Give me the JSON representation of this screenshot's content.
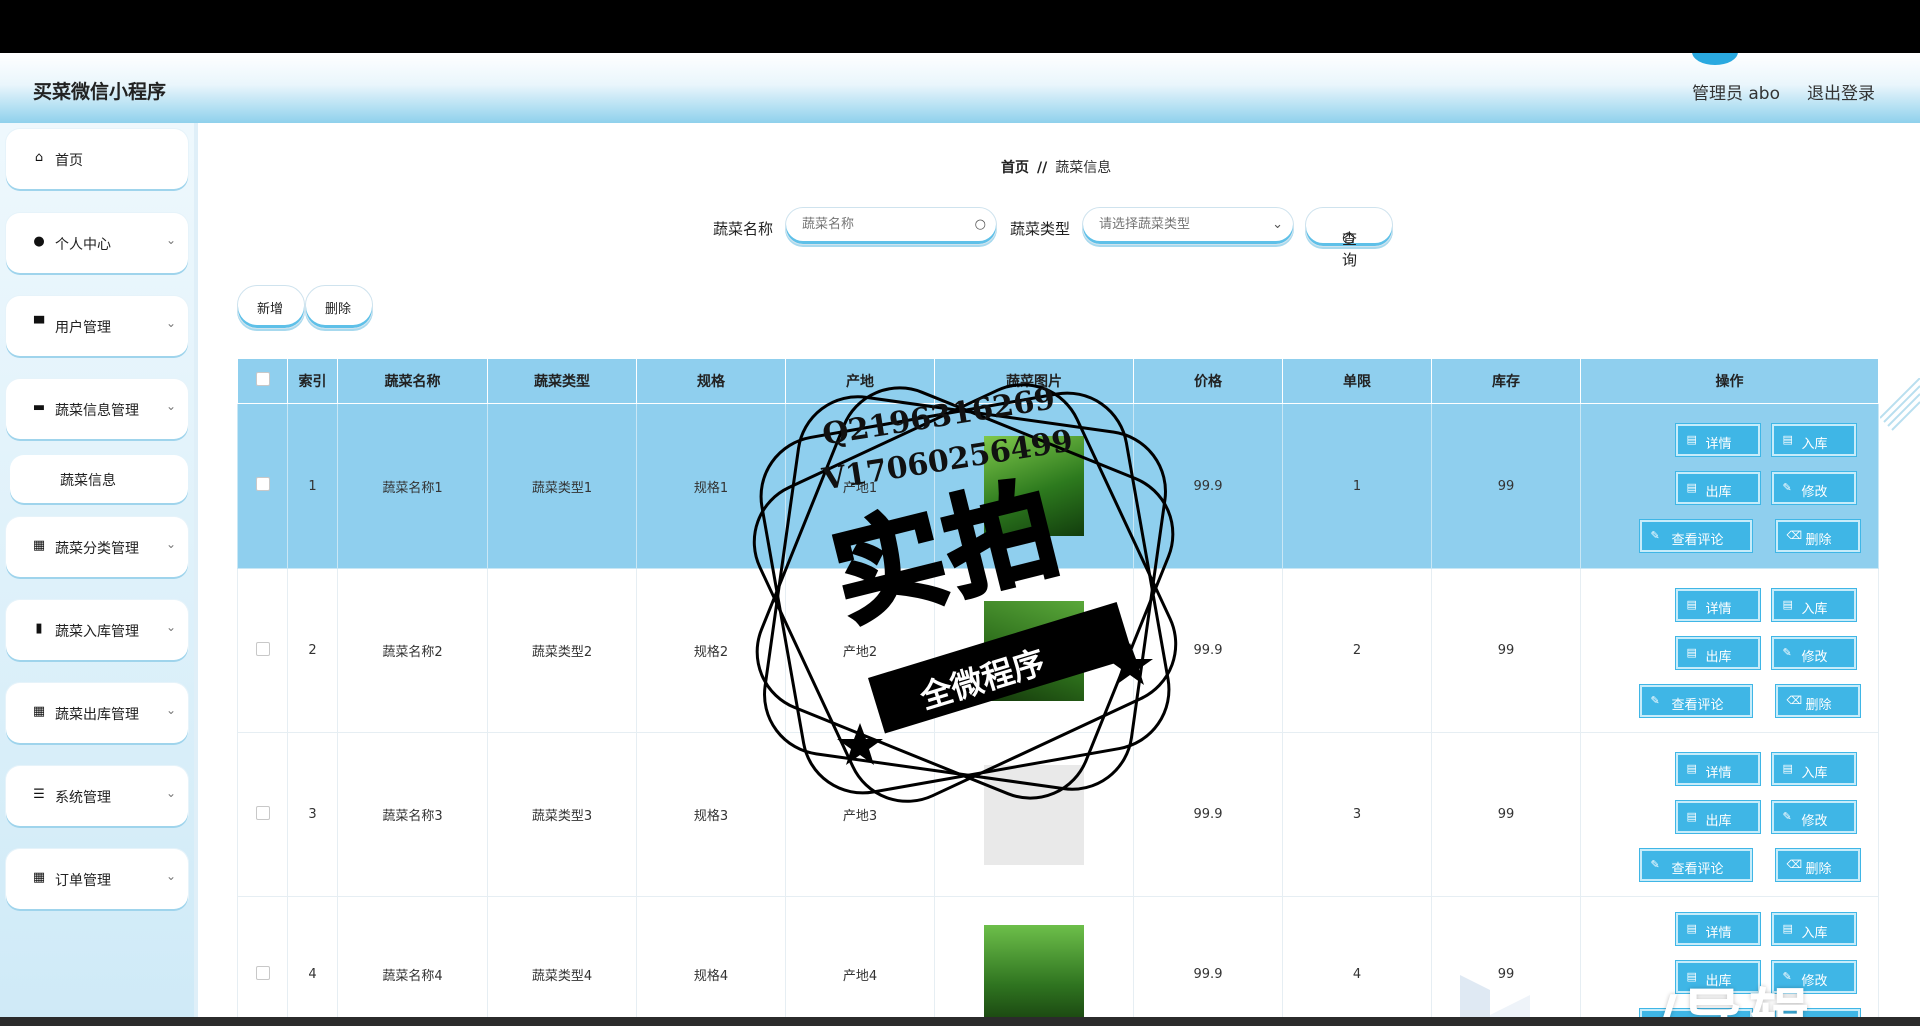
{
  "header": {
    "title": "买菜微信小程序",
    "user": "管理员 abo",
    "logout": "退出登录"
  },
  "sidebar": {
    "items": [
      {
        "label": "首页",
        "icon": "home-icon",
        "glyph": "⌂"
      },
      {
        "label": "个人中心",
        "icon": "user-icon",
        "glyph": "●"
      },
      {
        "label": "用户管理",
        "icon": "users-icon",
        "glyph": "▀"
      },
      {
        "label": "蔬菜信息管理",
        "icon": "chat-icon",
        "glyph": "▬"
      },
      {
        "label": "蔬菜分类管理",
        "icon": "grid-icon",
        "glyph": "▦"
      },
      {
        "label": "蔬菜入库管理",
        "icon": "inbox-icon",
        "glyph": "▮"
      },
      {
        "label": "蔬菜出库管理",
        "icon": "grid-icon",
        "glyph": "▦"
      },
      {
        "label": "系统管理",
        "icon": "list-icon",
        "glyph": "☰"
      },
      {
        "label": "订单管理",
        "icon": "grid-icon",
        "glyph": "▦"
      }
    ],
    "sub_item": "蔬菜信息"
  },
  "breadcrumb": {
    "home": "首页",
    "sep": "//",
    "current": "蔬菜信息"
  },
  "search": {
    "name_label": "蔬菜名称",
    "name_placeholder": "蔬菜名称",
    "type_label": "蔬菜类型",
    "type_placeholder": "请选择蔬菜类型",
    "query": "查询"
  },
  "actions": {
    "add": "新增",
    "delete": "删除"
  },
  "table": {
    "headers": [
      "索引",
      "蔬菜名称",
      "蔬菜类型",
      "规格",
      "产地",
      "蔬菜图片",
      "价格",
      "单限",
      "库存",
      "操作"
    ],
    "rows": [
      {
        "index": "1",
        "name": "蔬菜名称1",
        "type": "蔬菜类型1",
        "spec": "规格1",
        "origin": "产地1",
        "price": "99.9",
        "limit": "1",
        "stock": "99"
      },
      {
        "index": "2",
        "name": "蔬菜名称2",
        "type": "蔬菜类型2",
        "spec": "规格2",
        "origin": "产地2",
        "price": "99.9",
        "limit": "2",
        "stock": "99"
      },
      {
        "index": "3",
        "name": "蔬菜名称3",
        "type": "蔬菜类型3",
        "spec": "规格3",
        "origin": "产地3",
        "price": "99.9",
        "limit": "3",
        "stock": "99"
      },
      {
        "index": "4",
        "name": "蔬菜名称4",
        "type": "蔬菜类型4",
        "spec": "规格4",
        "origin": "产地4",
        "price": "99.9",
        "limit": "4",
        "stock": "99"
      }
    ],
    "op_labels": {
      "detail": "详情",
      "in": "入库",
      "out": "出库",
      "edit": "修改",
      "review": "查看评论",
      "delete": "删除"
    }
  },
  "watermark": {
    "qq": "Q2196316269",
    "vx": "V17060256499",
    "big": "实拍",
    "ribbon": "全微程序",
    "corner": "/导辑"
  }
}
